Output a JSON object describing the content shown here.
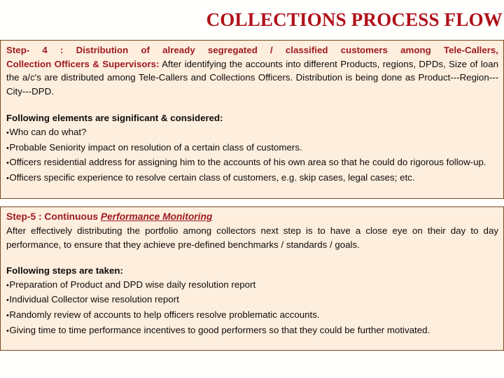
{
  "slide": {
    "title": "COLLECTIONS PROCESS FLOW",
    "title_color": "#b0111a",
    "box_background": "#fdeede",
    "box_border_color": "#7a4a21",
    "accent_red": "#9e1b22",
    "page_background": "#fffffd"
  },
  "step4": {
    "lead_line_1": "Step- 4 : Distribution of already segregated / classified customers among Tele-Callers,",
    "lead_line_2": "Collection Officers & Supervisors:",
    "body": " After identifying the accounts into different Products, regions, DPDs, Size of loan the a/c's are distributed among Tele-Callers and Collections Officers. Distribution is being done as Product---Region---City---DPD.",
    "elements_heading": "Following elements are significant & considered:",
    "bullets": [
      "Who can do what?",
      "Probable Seniority impact on resolution of a certain class of customers.",
      "Officers residential address for assigning him to the accounts of his own area so that he could do rigorous follow-up.",
      "Officers specific experience to resolve certain class of customers, e.g. skip cases, legal cases; etc."
    ]
  },
  "step5": {
    "head_prefix": "Step-5 : Continuous ",
    "head_emphasis": "Performance Monitoring",
    "body": "After effectively distributing the portfolio among collectors next step is to have a close eye on their day to day performance, to ensure that they achieve pre-defined benchmarks / standards / goals.",
    "steps_heading": "Following steps are taken:",
    "bullets": [
      "Preparation of Product and DPD wise daily resolution report",
      "Individual Collector wise resolution report",
      "Randomly review of accounts to help officers resolve problematic accounts.",
      "Giving time to time performance incentives to good performers so that they could be further motivated."
    ]
  }
}
